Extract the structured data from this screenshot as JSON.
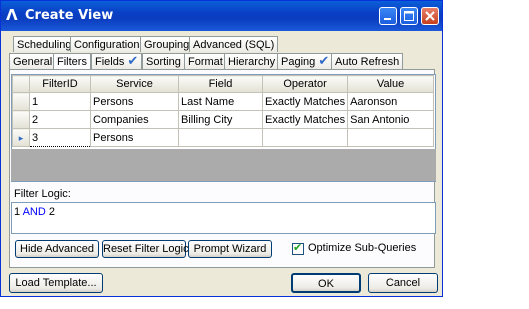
{
  "window": {
    "title": "Create View",
    "controls": [
      "minimize-icon",
      "maximize-icon",
      "close-icon"
    ]
  },
  "tabs_row1": [
    {
      "label": "Scheduling"
    },
    {
      "label": "Configuration"
    },
    {
      "label": "Grouping"
    },
    {
      "label": "Advanced (SQL)"
    }
  ],
  "tabs_row2": [
    {
      "label": "General"
    },
    {
      "label": "Filters",
      "active": true
    },
    {
      "label": "Fields",
      "checked": true
    },
    {
      "label": "Sorting"
    },
    {
      "label": "Format"
    },
    {
      "label": "Hierarchy"
    },
    {
      "label": "Paging",
      "checked": true
    },
    {
      "label": "Auto Refresh"
    }
  ],
  "grid": {
    "columns": [
      "FilterID",
      "Service",
      "Field",
      "Operator",
      "Value"
    ],
    "rows": [
      [
        "1",
        "Persons",
        "Last Name",
        "Exactly Matches",
        "Aaronson"
      ],
      [
        "2",
        "Companies",
        "Billing City",
        "Exactly Matches",
        "San Antonio"
      ],
      [
        "3",
        "Persons",
        "",
        "",
        ""
      ]
    ],
    "current_row_marker": "▸"
  },
  "filter_logic": {
    "label": "Filter Logic:",
    "expr_a": "1",
    "op": "AND",
    "expr_b": "2"
  },
  "buttons": {
    "hide_advanced": "Hide Advanced",
    "reset_filter_logic": "Reset Filter Logic",
    "prompt_wizard": "Prompt Wizard",
    "load_template": "Load Template...",
    "ok": "OK",
    "cancel": "Cancel"
  },
  "options": {
    "optimize_subqueries_label": "Optimize Sub-Queries",
    "optimize_subqueries_checked": true
  },
  "colors": {
    "title_bar": "#0a4fd0",
    "panel": "#ece9d8",
    "logic_keyword": "#0000ff",
    "check_mark": "#316ac5"
  }
}
